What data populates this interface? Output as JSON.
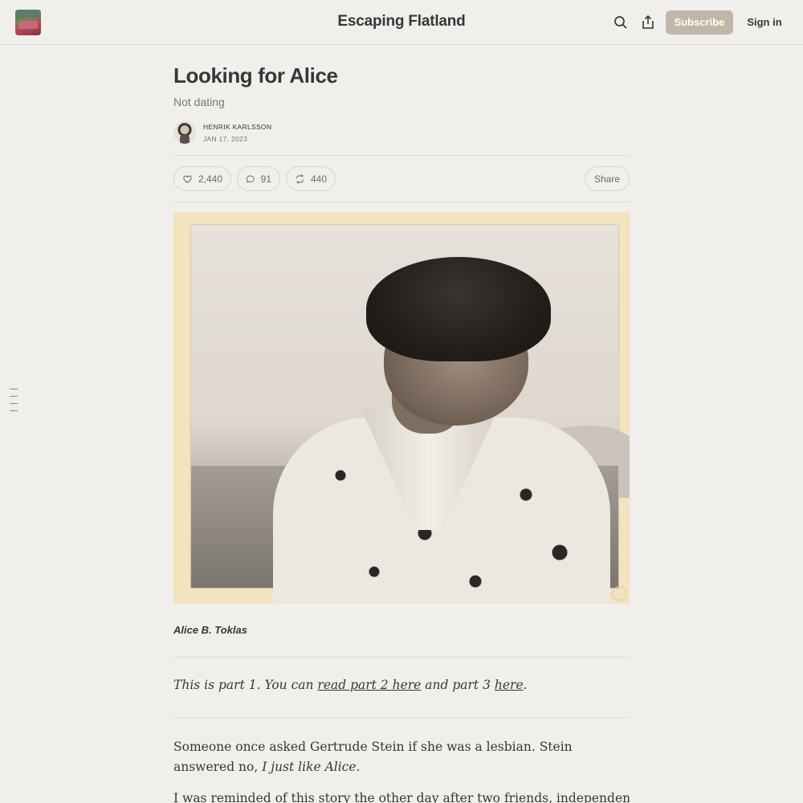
{
  "header": {
    "publication_title": "Escaping Flatland",
    "subscribe_label": "Subscribe",
    "signin_label": "Sign in",
    "icons": [
      "search-icon",
      "share-icon"
    ]
  },
  "post": {
    "title": "Looking for Alice",
    "subtitle": "Not dating",
    "author": "HENRIK KARLSSON",
    "date": "JAN 17, 2023",
    "likes": "2,440",
    "comments": "91",
    "restacks": "440",
    "share_label": "Share"
  },
  "image": {
    "caption": "Alice B. Toklas"
  },
  "note": {
    "prefix": "This is part 1. You can ",
    "link1": "read part 2 here",
    "middle": " and part 3 ",
    "link2": "here",
    "suffix": "."
  },
  "body": {
    "para1_text": "Someone once asked Gertrude Stein if she was a lesbian. Stein answered no, ",
    "para1_italic": "I just like Alice.",
    "para2_text": "I was reminded of this story the other day after two friends, independently of each"
  },
  "colors": {
    "background": "#f0efeb",
    "subscribe_bg": "#c2b5a9",
    "text": "#363737"
  }
}
